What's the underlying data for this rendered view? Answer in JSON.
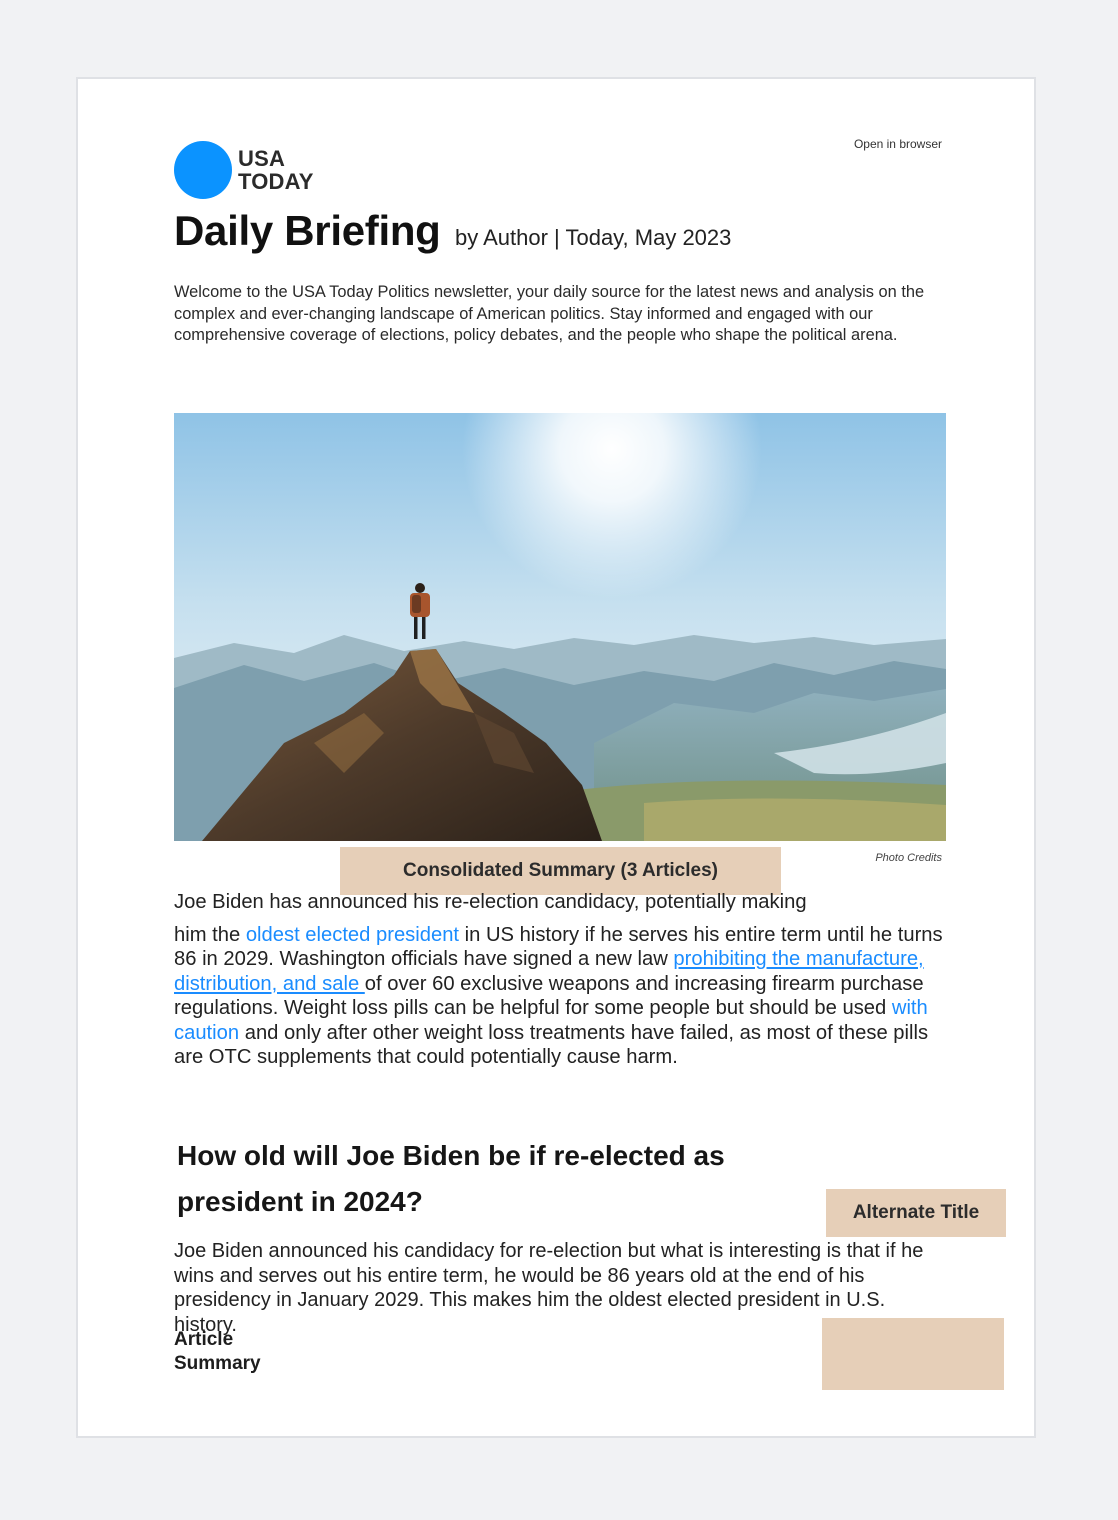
{
  "header": {
    "logo_line1": "USA",
    "logo_line2": "TODAY",
    "open_in_browser": "Open in browser"
  },
  "newsletter": {
    "title": "Daily Briefing",
    "byline": "by Author | Today, May 2023",
    "intro": "Welcome to the USA Today Politics newsletter, your daily source for the latest news and analysis on the complex and ever-changing landscape of American politics. Stay informed and engaged with our comprehensive coverage of elections, policy debates, and the people who shape the political arena."
  },
  "hero": {
    "photo_credits": "Photo Credits"
  },
  "summary": {
    "tag": "Consolidated Summary (3 Articles)",
    "line1": "Joe Biden has announced his re-election candidacy, potentially making",
    "t1": "him the ",
    "link1": "oldest elected president",
    "t2": " in US history if he serves his entire term until he turns 86 in 2029. Washington officials have signed a new law ",
    "link2": "prohibiting the manufacture, distribution, and sale ",
    "t3": "of over 60 exclusive weapons and increasing firearm purchase regulations. Weight loss pills can be helpful for some people but should be used ",
    "link3": "with caution",
    "t4": " and only after other weight loss treatments have failed, as most of these pills are OTC supplements that could potentially cause harm."
  },
  "article": {
    "title": "How old will Joe Biden be if re-elected as president in 2024?",
    "alt_title_tag": "Alternate Title",
    "body": "Joe Biden announced his candidacy for re-election but what is interesting is that if he wins and serves out his entire term, he would be 86 years old at the end of his presidency in January 2029. This makes him the oldest elected president in U.S. history.",
    "summary_label_line1": "Article",
    "summary_label_line2": "Summary"
  },
  "colors": {
    "logo_blue": "#0b93ff",
    "link_blue": "#1a8cff",
    "tag_beige": "#e6cfb8"
  }
}
